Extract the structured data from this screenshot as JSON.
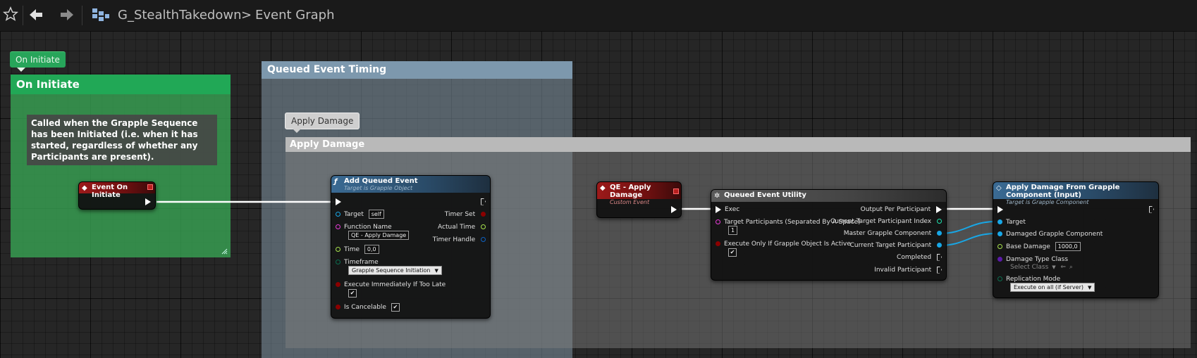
{
  "toolbar": {
    "blueprint_name": "G_StealthTakedown",
    "separator": ">",
    "graph_name": "Event Graph"
  },
  "comments": {
    "on_initiate": {
      "bubble": "On Initiate",
      "title": "On Initiate",
      "note": "Called when the Grapple Sequence has been Initiated (i.e. when it has started, regardless of whether any Participants are present)."
    },
    "queued_event_timing": {
      "title": "Queued Event Timing"
    },
    "apply_damage": {
      "bubble": "Apply Damage",
      "title": "Apply Damage"
    }
  },
  "nodes": {
    "event_on_initiate": {
      "title": "Event On Initiate"
    },
    "add_queued_event": {
      "title": "Add Queued Event",
      "subtitle": "Target is Grapple Object",
      "target_label": "Target",
      "target_value": "self",
      "function_name_label": "Function Name",
      "function_name_value": "QE - Apply Damage",
      "time_label": "Time",
      "time_value": "0,0",
      "timeframe_label": "Timeframe",
      "timeframe_value": "Grapple Sequence Initiation",
      "execute_immediately_label": "Execute Immediately If Too Late",
      "is_cancelable_label": "Is Cancelable",
      "timer_set_label": "Timer Set",
      "actual_time_label": "Actual Time",
      "timer_handle_label": "Timer Handle"
    },
    "qe_apply_damage": {
      "title": "QE - Apply Damage",
      "subtitle": "Custom Event"
    },
    "queued_event_utility": {
      "title": "Queued Event Utility",
      "exec_label": "Exec",
      "target_participants_label": "Target Participants (Separated By A Space)",
      "target_participants_value": "1",
      "execute_only_label": "Execute Only If Grapple Object Is Active",
      "output_per_participant_label": "Output Per Participant",
      "current_index_label": "Current Target Participant Index",
      "master_component_label": "Master Grapple Component",
      "current_participant_label": "Current Target Participant",
      "completed_label": "Completed",
      "invalid_participant_label": "Invalid Participant"
    },
    "apply_damage_from_grapple": {
      "title": "Apply Damage From Grapple Component (Input)",
      "subtitle": "Target is Grapple Component",
      "target_label": "Target",
      "damaged_component_label": "Damaged Grapple Component",
      "base_damage_label": "Base Damage",
      "base_damage_value": "1000,0",
      "damage_type_label": "Damage Type Class",
      "damage_type_value": "Select Class",
      "replication_label": "Replication Mode",
      "replication_value": "Execute on all (if Server)"
    }
  },
  "colors": {
    "graph_bg": "#262626",
    "comment_green": "#21a856",
    "comment_blue": "#7d98ad",
    "comment_gray": "#b9b9b9",
    "function_head": "#3a6a93",
    "event_head": "#9c1a1a",
    "pin_object": "#18a7e6",
    "pin_string": "#e83bd8",
    "pin_float": "#a8e34d",
    "pin_bool": "#8b0000",
    "pin_enum": "#0a6e4f",
    "pin_class": "#5b1aa8"
  }
}
